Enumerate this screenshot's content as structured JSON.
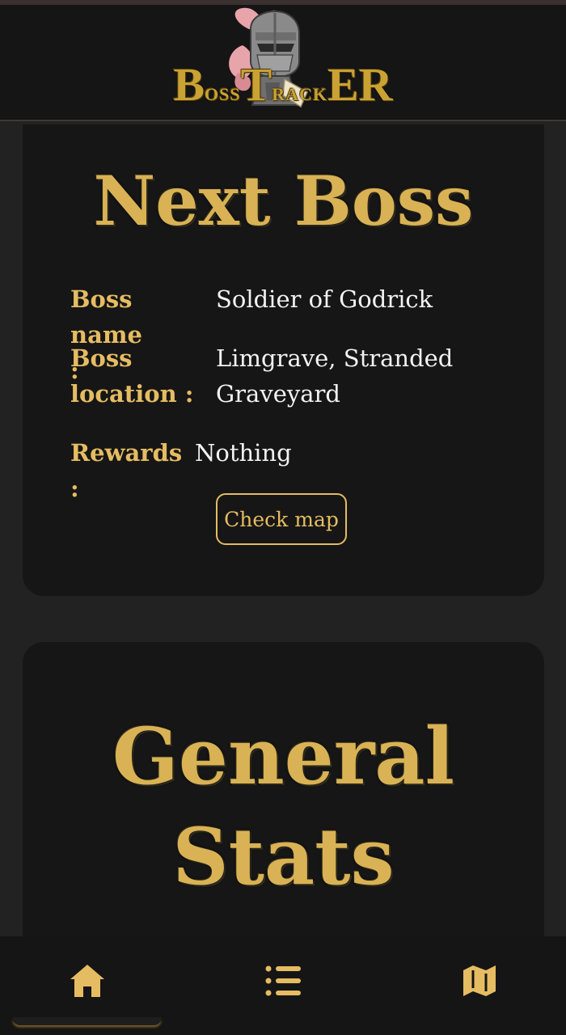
{
  "header": {
    "logo": {
      "word_part_1": "B",
      "word_part_2": "OSS",
      "word_part_3": "T",
      "word_part_4": "RACK",
      "word_part_5": "ER"
    }
  },
  "next_boss": {
    "title": "Next Boss",
    "name_label": "Boss name :",
    "name_value": "Soldier of Godrick",
    "location_label": "Boss location :",
    "location_value": "Limgrave, Stranded Graveyard",
    "rewards_label": "Rewards :",
    "rewards_value": "Nothing",
    "check_map_label": "Check map"
  },
  "general_stats": {
    "title": "General Stats"
  },
  "bottom_nav": {
    "items": [
      {
        "icon": "home-icon",
        "active": true
      },
      {
        "icon": "list-icon",
        "active": false
      },
      {
        "icon": "map-icon",
        "active": false
      }
    ]
  },
  "colors": {
    "accent_gold": "#e6bc62",
    "title_gold": "#d8b254",
    "logo_gold": "#c9a233",
    "background": "#222222",
    "card": "#161616",
    "text": "#f2f2f2"
  }
}
